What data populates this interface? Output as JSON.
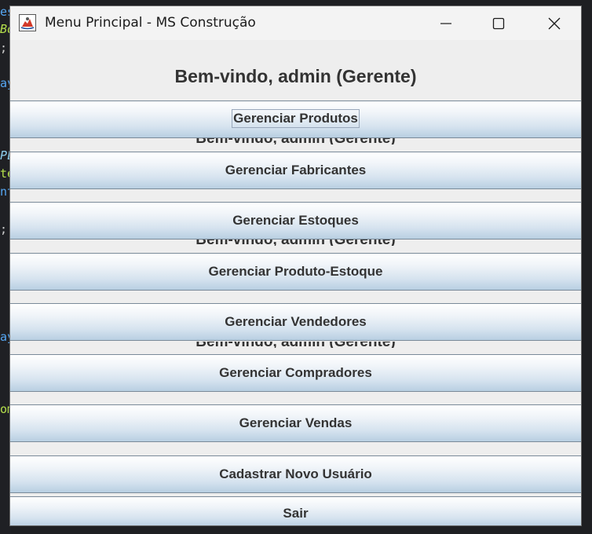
{
  "window": {
    "title": "Menu Principal - MS Construção"
  },
  "welcome": "Bem-vindo, admin (Gerente)",
  "ghost_text": "Bem-vindo, admin (Gerente)",
  "buttons": [
    {
      "label": "Gerenciar Produtos"
    },
    {
      "label": "Gerenciar Fabricantes"
    },
    {
      "label": "Gerenciar Estoques"
    },
    {
      "label": "Gerenciar Produto-Estoque"
    },
    {
      "label": "Gerenciar Vendedores"
    },
    {
      "label": "Gerenciar Compradores"
    },
    {
      "label": "Gerenciar Vendas"
    },
    {
      "label": "Cadastrar Novo Usuário"
    },
    {
      "label": "Sair"
    }
  ],
  "bg_code": [
    "es",
    "Bo",
    ";",
    "ay",
    "PL",
    "te",
    "nt",
    ";",
    "ay",
    "om"
  ],
  "colors": {
    "button_top": "#ffffff",
    "button_bottom": "#b8cfe2",
    "window_bg": "#eeeeee",
    "text": "#333333"
  },
  "icons": [
    "java-app-icon",
    "minimize-icon",
    "maximize-icon",
    "close-icon"
  ]
}
